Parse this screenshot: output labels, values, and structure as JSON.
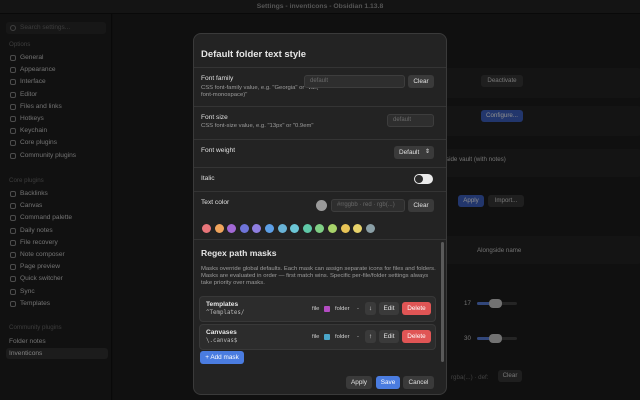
{
  "window": {
    "title": "Settings - inventicons - Obsidian 1.13.8"
  },
  "sidebar": {
    "search_placeholder": "Search settings...",
    "options_label": "Options",
    "options": [
      "General",
      "Appearance",
      "Interface",
      "Editor",
      "Files and links",
      "Hotkeys",
      "Keychain",
      "Core plugins",
      "Community plugins"
    ],
    "core_label": "Core plugins",
    "core": [
      "Backlinks",
      "Canvas",
      "Command palette",
      "Daily notes",
      "File recovery",
      "Note composer",
      "Page preview",
      "Quick switcher",
      "Sync",
      "Templates"
    ],
    "community_label": "Community plugins",
    "community": [
      "Folder notes",
      "Inventicons"
    ],
    "active_item": "Inventicons"
  },
  "background": {
    "deactivate": "Deactivate",
    "configure": "Configure...",
    "vault_text": "side vault (with notes)",
    "apply": "Apply",
    "import": "Import...",
    "alongside": "Alongside name",
    "slider1_value": "17",
    "slider2_value": "30",
    "clear_hint": "rgba(...) · def:",
    "clear": "Clear"
  },
  "modal": {
    "title": "Default folder text style",
    "font_family": {
      "label": "Font family",
      "desc": "CSS font-family value, e.g. \"Georgia\" or \"var(--font-monospace)\"",
      "placeholder": "default",
      "clear": "Clear"
    },
    "font_size": {
      "label": "Font size",
      "desc": "CSS font-size value, e.g. \"13px\" or \"0.9em\"",
      "placeholder": "default"
    },
    "font_weight": {
      "label": "Font weight",
      "value": "Default"
    },
    "italic": {
      "label": "Italic",
      "on": true
    },
    "text_color": {
      "label": "Text color",
      "placeholder": "#rrggbb · red · rgb(...)",
      "clear": "Clear"
    },
    "swatches": [
      "#e8757a",
      "#f0a45c",
      "#a268d4",
      "#6f74d8",
      "#8f7ee0",
      "#5d9fe6",
      "#69b3d6",
      "#6cc6d6",
      "#5fc9a8",
      "#7fcf85",
      "#a8d36a",
      "#e8c456",
      "#e8d36b",
      "#8a9fa6"
    ],
    "regex_title": "Regex path masks",
    "regex_desc": "Masks override global defaults. Each mask can assign separate icons for files and folders. Masks are evaluated in order — first match wins. Specific per-file/folder settings always take priority over masks.",
    "masks": [
      {
        "name": "Templates",
        "pattern": "^Templates/",
        "file_label": "file",
        "file_icon_color": "#b34cc2",
        "folder_label": "folder",
        "folder_value": "-",
        "arrow": "↓",
        "edit": "Edit",
        "delete": "Delete"
      },
      {
        "name": "Canvases",
        "pattern": "\\.canvas$",
        "file_label": "file",
        "file_icon_color": "#4aa6c9",
        "folder_label": "folder",
        "folder_value": "-",
        "arrow": "↑",
        "edit": "Edit",
        "delete": "Delete"
      }
    ],
    "add_mask": "+ Add mask",
    "footer": {
      "apply": "Apply",
      "save": "Save",
      "cancel": "Cancel"
    }
  }
}
